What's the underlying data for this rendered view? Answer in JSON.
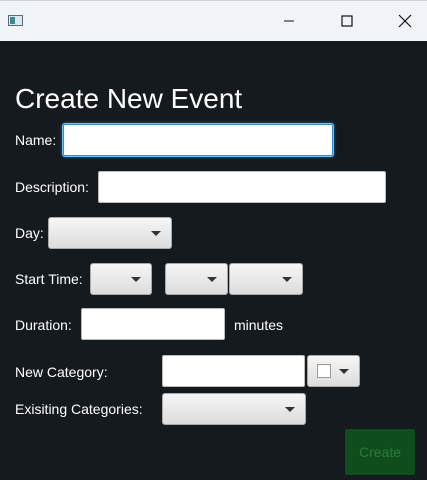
{
  "window": {
    "minimize_icon": "minimize-icon",
    "maximize_icon": "maximize-icon",
    "close_icon": "close-icon"
  },
  "form": {
    "heading": "Create New Event",
    "name": {
      "label": "Name:",
      "value": ""
    },
    "description": {
      "label": "Description:",
      "value": ""
    },
    "day": {
      "label": "Day:",
      "selected": ""
    },
    "start_time": {
      "label": "Start Time:",
      "hour": "",
      "minute": "",
      "period": ""
    },
    "duration": {
      "label": "Duration:",
      "value": "",
      "unit": "minutes"
    },
    "new_category": {
      "label": "New Category:",
      "value": "",
      "color": "#ffffff"
    },
    "existing_categories": {
      "label": "Exisiting Categories:",
      "selected": ""
    },
    "create_label": "Create"
  },
  "colors": {
    "background": "#151a1f",
    "titlebar": "#f0f3f8",
    "create_button": "#0f4d1c",
    "create_text": "#2c7a3d",
    "focus": "#2a8fd0"
  }
}
